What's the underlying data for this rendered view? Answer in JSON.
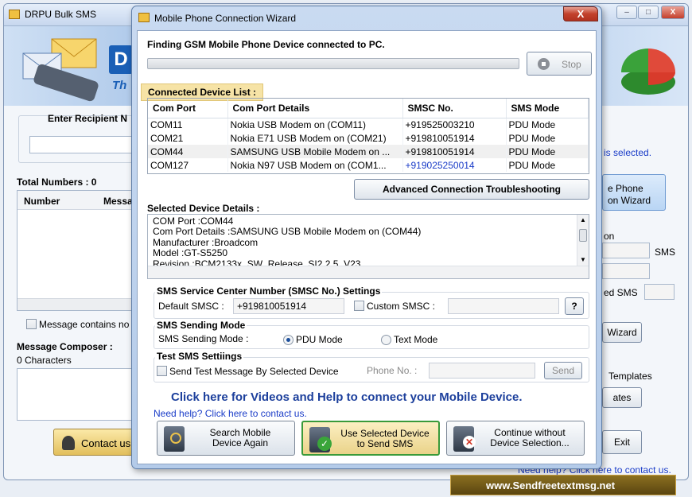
{
  "background_app": {
    "title": "DRPU Bulk SMS",
    "enter_recipient": "Enter Recipient N",
    "total_numbers": "Total Numbers : 0",
    "columns": [
      "Number",
      "Messa"
    ],
    "message_contains": "Message contains no",
    "message_composer": "Message Composer :",
    "characters": "0 Characters",
    "contact_us": "Contact us",
    "is_selected": "is selected.",
    "phone_wizard_line1": "e Phone",
    "phone_wizard_line2": "on  Wizard",
    "on_text": "on",
    "sms_label": "SMS",
    "ed_sms": "ed SMS",
    "wizard_btn": "Wizard",
    "templates": "Templates",
    "ates_btn": "ates",
    "exit_btn": "Exit",
    "need_help": "Need help? Click here to contact us.",
    "website": "www.Sendfreetextmsg.net"
  },
  "dialog": {
    "title": "Mobile Phone Connection Wizard",
    "finding": "Finding GSM Mobile Phone Device connected to PC.",
    "stop": "Stop",
    "connected_list": "Connected Device List :",
    "columns": [
      "Com Port",
      "Com Port Details",
      "SMSC No.",
      "SMS Mode"
    ],
    "rows": [
      [
        "COM11",
        "Nokia USB Modem on (COM11)",
        "+919525003210",
        "PDU Mode"
      ],
      [
        "COM21",
        "Nokia E71 USB Modem on (COM21)",
        "+919810051914",
        "PDU Mode"
      ],
      [
        "COM44",
        "SAMSUNG USB Mobile Modem on ...",
        "+919810051914",
        "PDU Mode"
      ],
      [
        "COM127",
        "Nokia N97 USB Modem on (COM1...",
        "+919025250014",
        "PDU Mode"
      ]
    ],
    "advanced": "Advanced Connection Troubleshooting",
    "selected_details_label": "Selected Device Details :",
    "details": [
      "COM Port :COM44",
      "Com Port Details :SAMSUNG USB Mobile Modem on (COM44)",
      "Manufacturer :Broadcom",
      "Model :GT-S5250",
      "Revision :BCM2133x_SW_Release_SI2.2.5_V23"
    ],
    "smsc_section": "SMS Service Center Number (SMSC No.) Settings",
    "default_smsc_label": "Default SMSC :",
    "default_smsc_value": "+919810051914",
    "custom_smsc": "Custom SMSC :",
    "help_q": "?",
    "sending_mode_section": "SMS Sending Mode",
    "sending_mode_label": "SMS Sending Mode :",
    "pdu_mode": "PDU Mode",
    "text_mode": "Text Mode",
    "test_section": "Test SMS Settiings",
    "send_test": "Send Test Message By Selected Device",
    "phone_no": "Phone No. :",
    "send": "Send",
    "videos_help": "Click here for Videos and Help to connect your Mobile Device.",
    "need_help": "Need help? Click here to contact us.",
    "search_btn": [
      "Search Mobile",
      "Device Again"
    ],
    "use_btn": [
      "Use Selected Device",
      "to Send SMS"
    ],
    "continue_btn": [
      "Continue without",
      "Device Selection..."
    ]
  },
  "colors": {
    "accent": "#1c3f9c",
    "link": "#1a3cc8",
    "highlight": "#f6e3a6"
  }
}
